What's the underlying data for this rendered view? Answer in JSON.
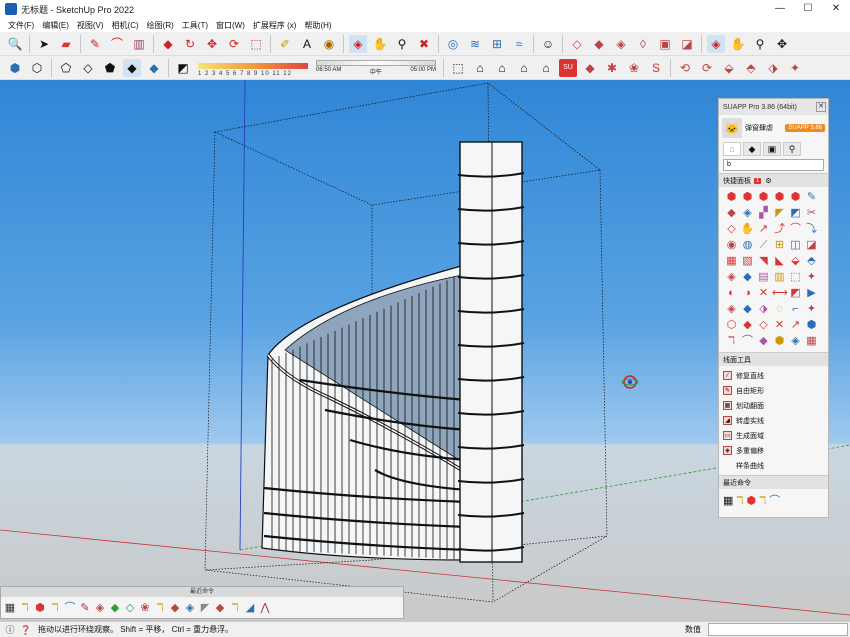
{
  "window": {
    "title": "无标题 - SketchUp Pro 2022",
    "controls": [
      "—",
      "☐",
      "✕"
    ]
  },
  "menu": [
    "文件(F)",
    "编辑(E)",
    "视图(V)",
    "相机(C)",
    "绘图(R)",
    "工具(T)",
    "窗口(W)",
    "扩展程序 (x)",
    "帮助(H)"
  ],
  "toolbar1": {
    "icons": [
      "search-icon",
      "cursor-icon",
      "eraser-icon",
      "pencil-icon",
      "arc-icon",
      "rectangle-icon",
      "pushpull-icon",
      "rotate-icon",
      "move-icon",
      "refresh-icon",
      "scale-icon",
      "tape-icon",
      "text-icon",
      "paint-icon",
      "orbit-icon",
      "pan-icon",
      "zoom-icon",
      "zoom-extents-icon",
      "ext-a-icon",
      "ext-b-icon",
      "ext-c-icon",
      "ext-d-icon",
      "user-icon",
      "layer-a-icon",
      "layer-b-icon",
      "layer-c-icon",
      "layer-d-icon",
      "layer-e-icon",
      "layer-f-icon",
      "orbit2-icon",
      "hand-icon",
      "zoom2-icon",
      "pan2-icon"
    ]
  },
  "toolbar2": {
    "shadow_scale": "1 2 3 4 5 6 7 8 9 10 11 12",
    "time_start": "06:50 AM",
    "time_mid": "中午",
    "time_end": "05:00 PM"
  },
  "suapp": {
    "title": "SUAPP Pro 3.86 (64bit)",
    "close": "✕",
    "user": "弹窗肆虐",
    "badge": "SUAPP 3.86",
    "search_value": "b",
    "quick_panel": "快捷面板",
    "quick_count": "1",
    "line_tools": "线面工具",
    "line_items": [
      "修复直线",
      "自由矩形",
      "划动翻面",
      "转虚实线",
      "生成面域",
      "多重偏移",
      "样条曲线"
    ],
    "recent": "最近命令"
  },
  "floating_toolbar": {
    "title": "最近命令"
  },
  "status": {
    "message": "拖动以进行环绕观察。 Shift = 平移， Ctrl = 重力悬浮。",
    "value_label": "数值"
  },
  "colors": {
    "sky_top": "#2f86d6",
    "ground": "#c9c9c9",
    "accent_orange": "#f08a1c"
  }
}
